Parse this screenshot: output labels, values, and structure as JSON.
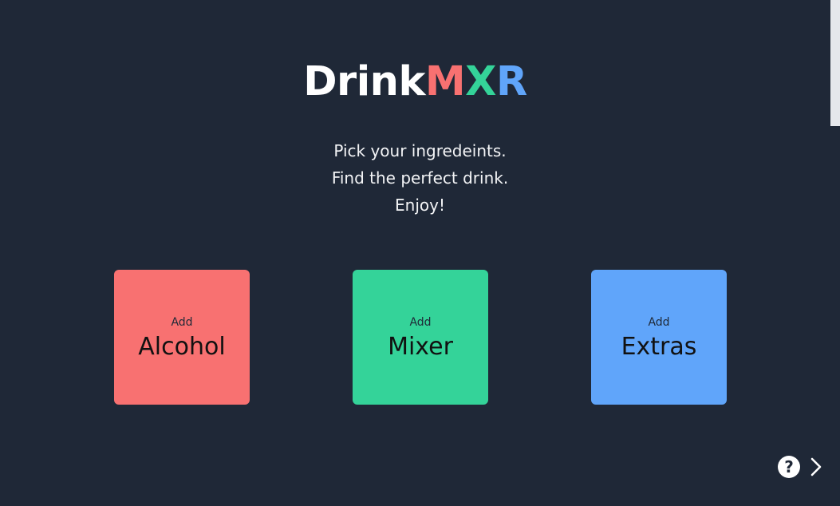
{
  "logo": {
    "part1": "Drink",
    "part2": "M",
    "part3": "X",
    "part4": "R"
  },
  "tagline": {
    "line1": "Pick your ingredeints.",
    "line2": "Find the perfect drink.",
    "line3": "Enjoy!"
  },
  "cards": [
    {
      "prefix": "Add",
      "label": "Alcohol",
      "color": "#f87171"
    },
    {
      "prefix": "Add",
      "label": "Mixer",
      "color": "#34d399"
    },
    {
      "prefix": "Add",
      "label": "Extras",
      "color": "#60a5fa"
    }
  ],
  "footer": {
    "help_icon": "question-circle-icon",
    "help_glyph": "?",
    "next_icon": "chevron-right-icon"
  },
  "colors": {
    "background": "#1f2837",
    "accent_red": "#f87171",
    "accent_green": "#34d399",
    "accent_blue": "#60a5fa"
  }
}
